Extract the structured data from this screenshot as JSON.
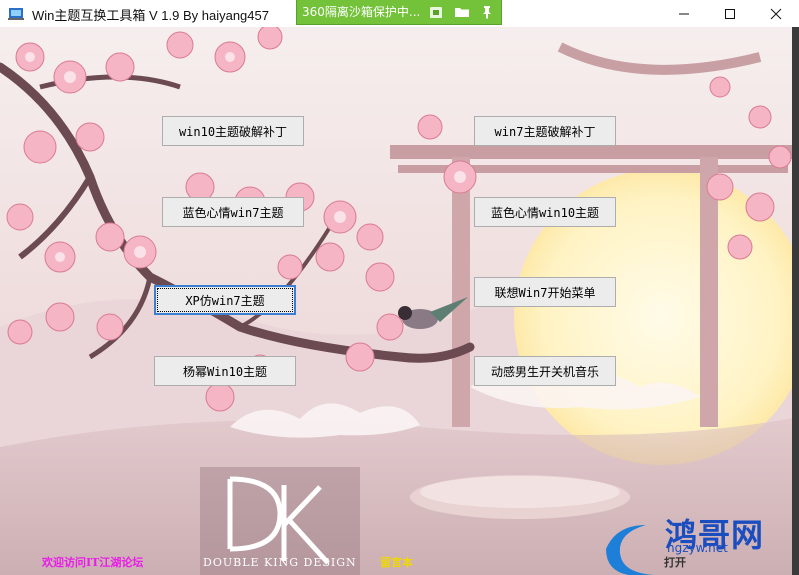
{
  "window": {
    "title": "Win主题互换工具箱 V 1.9  By haiyang457",
    "sandbox_label": "360隔离沙箱保护中...",
    "icons": [
      "app-icon",
      "minimize-icon",
      "maximize-icon",
      "close-icon",
      "sandbox-shield-icon",
      "folder-icon",
      "pin-icon"
    ]
  },
  "buttons": {
    "win10_patch": "win10主题破解补丁",
    "win7_patch": "win7主题破解补丁",
    "blue_win7": "蓝色心情win7主题",
    "blue_win10": "蓝色心情win10主题",
    "xp_win7": "XP仿win7主题",
    "lenovo_start": "联想Win7开始菜单",
    "yangmi_win10": "杨幂Win10主题",
    "boot_music": "动感男生开关机音乐"
  },
  "footer": {
    "visit": "欢迎访问IT江湖论坛",
    "message": "留言本",
    "favorite": "打开"
  },
  "logo": {
    "mark": "DK",
    "caption": "DOUBLE KING DESIGN"
  },
  "watermark": {
    "site": "鸿哥网",
    "url": "hgzyw.net"
  },
  "colors": {
    "sandbox_green": "#73c23a",
    "visit_link": "#e61ee6",
    "message_link": "#f0d800",
    "focus_border": "#3c7fd0"
  }
}
